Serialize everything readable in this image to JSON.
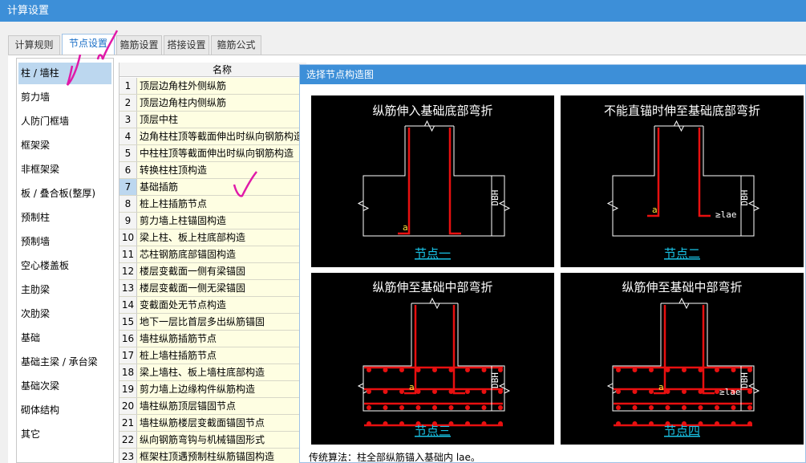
{
  "window": {
    "title": "计算设置"
  },
  "tabs": [
    {
      "label": "计算规则"
    },
    {
      "label": "节点设置"
    },
    {
      "label": "箍筋设置"
    },
    {
      "label": "搭接设置"
    },
    {
      "label": "箍筋公式"
    }
  ],
  "sidebar": {
    "items": [
      {
        "label": "柱 / 墙柱"
      },
      {
        "label": "剪力墙"
      },
      {
        "label": "人防门框墙"
      },
      {
        "label": "框架梁"
      },
      {
        "label": "非框架梁"
      },
      {
        "label": "板 / 叠合板(整厚)"
      },
      {
        "label": "预制柱"
      },
      {
        "label": "预制墙"
      },
      {
        "label": "空心楼盖板"
      },
      {
        "label": "主肋梁"
      },
      {
        "label": "次肋梁"
      },
      {
        "label": "基础"
      },
      {
        "label": "基础主梁 / 承台梁"
      },
      {
        "label": "基础次梁"
      },
      {
        "label": "砌体结构"
      },
      {
        "label": "其它"
      }
    ]
  },
  "grid": {
    "header": "名称",
    "rows": [
      {
        "num": "1",
        "name": "顶层边角柱外侧纵筋"
      },
      {
        "num": "2",
        "name": "顶层边角柱内侧纵筋"
      },
      {
        "num": "3",
        "name": "顶层中柱"
      },
      {
        "num": "4",
        "name": "边角柱柱顶等截面伸出时纵向钢筋构造"
      },
      {
        "num": "5",
        "name": "中柱柱顶等截面伸出时纵向钢筋构造"
      },
      {
        "num": "6",
        "name": "转换柱柱顶构造"
      },
      {
        "num": "7",
        "name": "基础插筋"
      },
      {
        "num": "8",
        "name": "桩上柱插筋节点"
      },
      {
        "num": "9",
        "name": "剪力墙上柱锚固构造"
      },
      {
        "num": "10",
        "name": "梁上柱、板上柱底部构造"
      },
      {
        "num": "11",
        "name": "芯柱钢筋底部锚固构造"
      },
      {
        "num": "12",
        "name": "楼层变截面一侧有梁锚固"
      },
      {
        "num": "13",
        "name": "楼层变截面一侧无梁锚固"
      },
      {
        "num": "14",
        "name": "变截面处无节点构造"
      },
      {
        "num": "15",
        "name": "地下一层比首层多出纵筋锚固"
      },
      {
        "num": "16",
        "name": "墙柱纵筋插筋节点"
      },
      {
        "num": "17",
        "name": "桩上墙柱插筋节点"
      },
      {
        "num": "18",
        "name": "梁上墙柱、板上墙柱底部构造"
      },
      {
        "num": "19",
        "name": "剪力墙上边缘构件纵筋构造"
      },
      {
        "num": "20",
        "name": "墙柱纵筋顶层锚固节点"
      },
      {
        "num": "21",
        "name": "墙柱纵筋楼层变截面锚固节点"
      },
      {
        "num": "22",
        "name": "纵向钢筋弯钩与机械锚固形式"
      },
      {
        "num": "23",
        "name": "框架柱顶遇预制柱纵筋锚固构造"
      }
    ]
  },
  "dialog": {
    "title": "选择节点构造图",
    "nodes": [
      {
        "heading": "纵筋伸入基础底部弯折",
        "caption": "节点一",
        "dim": "DBH",
        "a": "a"
      },
      {
        "heading": "不能直锚时伸至基础底部弯折",
        "caption": "节点二",
        "dim": "DBH",
        "a": "a",
        "lae": "≥lae"
      },
      {
        "heading": "纵筋伸至基础中部弯折",
        "caption": "节点三",
        "dim": "DBH",
        "a": "a"
      },
      {
        "heading": "纵筋伸至基础中部弯折",
        "caption": "节点四",
        "dim": "DBH",
        "a": "a",
        "lae": "≥lae"
      }
    ]
  },
  "status": {
    "text": "传统算法：柱全部纵筋锚入基础内 lae。"
  },
  "colors": {
    "titlebar": "#3d8fd8",
    "selection": "#bcd7ef",
    "rebar": "#e81010",
    "caption": "#19c3e6",
    "annotation": "#e01aa8"
  }
}
